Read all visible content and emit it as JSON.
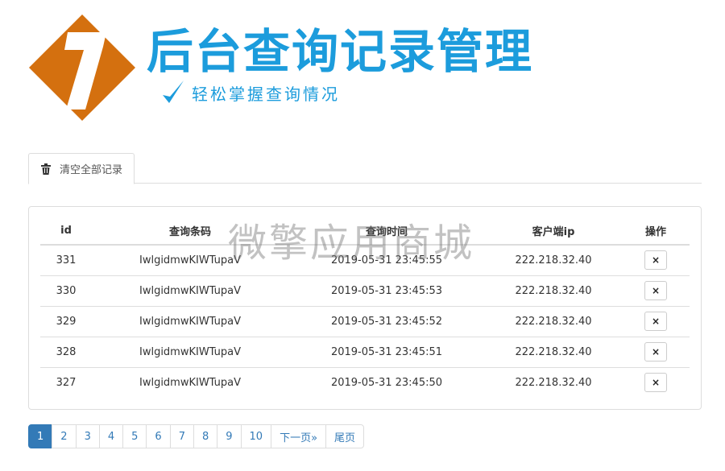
{
  "header": {
    "logo_number": "7",
    "title": "后台查询记录管理",
    "subtitle": "轻松掌握查询情况",
    "accent_color": "#1c9cdc",
    "logo_color": "#d4700f"
  },
  "tabs": [
    {
      "label": "清空全部记录",
      "icon": "trash-icon"
    }
  ],
  "table": {
    "columns": [
      "id",
      "查询条码",
      "查询时间",
      "客户端ip",
      "操作"
    ],
    "delete_glyph": "×",
    "rows": [
      {
        "id": "331",
        "code": "IwlgidmwKIWTupaV",
        "time": "2019-05-31 23:45:55",
        "ip": "222.218.32.40"
      },
      {
        "id": "330",
        "code": "IwlgidmwKIWTupaV",
        "time": "2019-05-31 23:45:53",
        "ip": "222.218.32.40"
      },
      {
        "id": "329",
        "code": "IwlgidmwKIWTupaV",
        "time": "2019-05-31 23:45:52",
        "ip": "222.218.32.40"
      },
      {
        "id": "328",
        "code": "IwlgidmwKIWTupaV",
        "time": "2019-05-31 23:45:51",
        "ip": "222.218.32.40"
      },
      {
        "id": "327",
        "code": "IwlgidmwKIWTupaV",
        "time": "2019-05-31 23:45:50",
        "ip": "222.218.32.40"
      }
    ]
  },
  "watermark": "微擎应用商城",
  "pagination": {
    "pages": [
      "1",
      "2",
      "3",
      "4",
      "5",
      "6",
      "7",
      "8",
      "9",
      "10"
    ],
    "active": "1",
    "next_label": "下一页»",
    "last_label": "尾页"
  }
}
